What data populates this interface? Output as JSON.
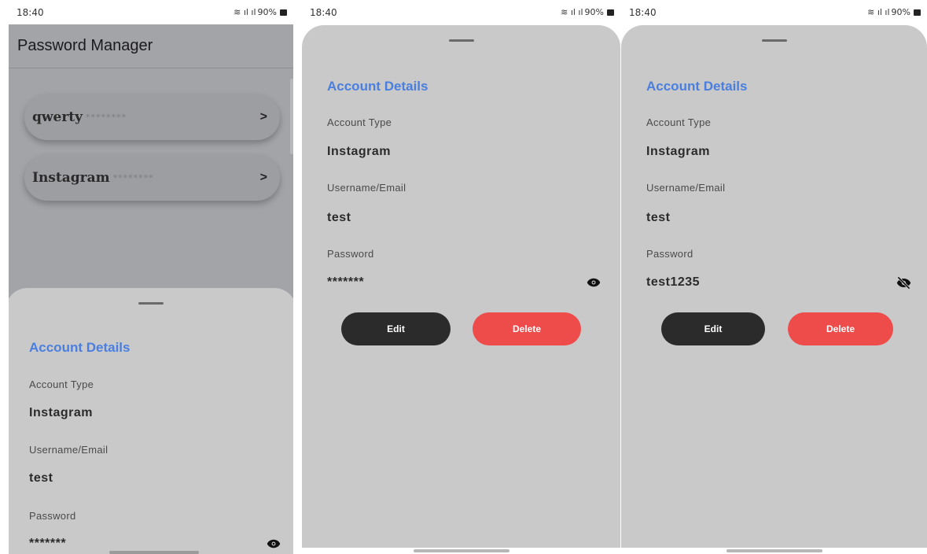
{
  "status": {
    "time": "18:40",
    "icons": "wifi-volte-lte-signal-icons",
    "battery": "90%"
  },
  "app": {
    "title": "Password Manager"
  },
  "list": [
    {
      "name": "qwerty",
      "mask": "********",
      "chevron": ">"
    },
    {
      "name": "Instagram",
      "mask": "********",
      "chevron": ">"
    }
  ],
  "details": {
    "heading": "Account Details",
    "account_type_label": "Account Type",
    "account_type": "Instagram",
    "username_label": "Username/Email",
    "username": "test",
    "password_label": "Password",
    "password_masked": "*******",
    "password_revealed": "test1235",
    "edit": "Edit",
    "delete": "Delete"
  },
  "colors": {
    "accent": "#4a7fe0",
    "delete": "#ee4b4b",
    "edit": "#2b2b2b",
    "sheet": "#c9c9c9"
  }
}
